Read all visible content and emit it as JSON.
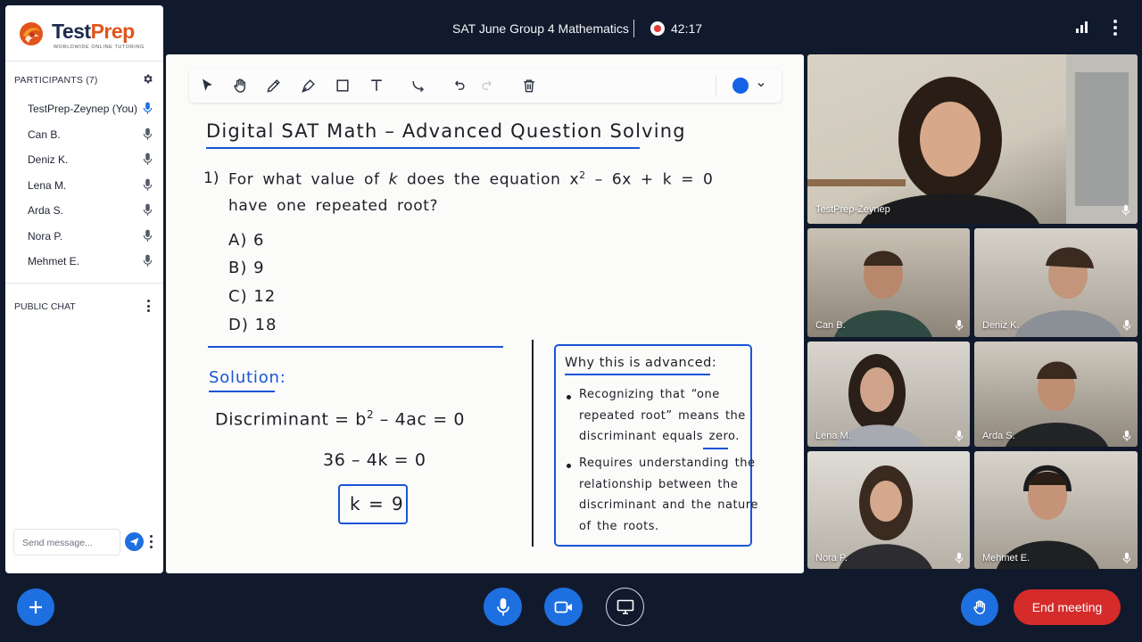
{
  "meeting": {
    "title": "SAT June Group 4 Mathematics",
    "timer": "42:17"
  },
  "brand": {
    "name_part1": "Test",
    "name_part2": "Prep",
    "tagline": "WORLDWIDE ONLINE TUTORING"
  },
  "participants": {
    "heading": "PARTICIPANTS (7)",
    "items": [
      {
        "name": "TestPrep-Zeynep (You)",
        "speaking": true
      },
      {
        "name": "Can B.",
        "speaking": false
      },
      {
        "name": "Deniz K.",
        "speaking": false
      },
      {
        "name": "Lena M.",
        "speaking": false
      },
      {
        "name": "Arda S.",
        "speaking": false
      },
      {
        "name": "Nora P.",
        "speaking": false
      },
      {
        "name": "Mehmet E.",
        "speaking": false
      }
    ]
  },
  "chat": {
    "heading": "PUBLIC CHAT",
    "placeholder": "Send message..."
  },
  "board": {
    "title": "Digital SAT Math – Advanced Question Solving",
    "question_number": "1)",
    "question_line1_a": "For what value of ",
    "question_var": "k",
    "question_line1_b": " does the equation  x",
    "question_exp": "2",
    "question_line1_c": " – 6x + k = 0",
    "question_line2": "have one repeated root?",
    "choices": [
      "A)  6",
      "B)  9",
      "C)  12",
      "D)  18"
    ],
    "solution_label": "Solution:",
    "eq1_a": "Discriminant  =  b",
    "eq1_exp": "2",
    "eq1_b": " – 4ac  =  0",
    "eq2": "36 – 4k = 0",
    "answer": "k = 9",
    "why_title": "Why this is advanced:",
    "why_lines": [
      "Recognizing that “one",
      "repeated root” means the",
      "discriminant equals zero.",
      "Requires understanding the",
      "relationship between the",
      "discriminant and the nature",
      "of the roots."
    ],
    "pen_color": "#1462e6"
  },
  "tiles": [
    {
      "name": "TestPrep-Zeynep"
    },
    {
      "name": "Can B."
    },
    {
      "name": "Deniz K."
    },
    {
      "name": "Lena M."
    },
    {
      "name": "Arda S."
    },
    {
      "name": "Nora P."
    },
    {
      "name": "Mehmet E."
    }
  ],
  "controls": {
    "end_label": "End meeting"
  },
  "colors": {
    "accent": "#1e6fe0",
    "end": "#d52b2b",
    "ink_blue": "#1a55d6"
  }
}
